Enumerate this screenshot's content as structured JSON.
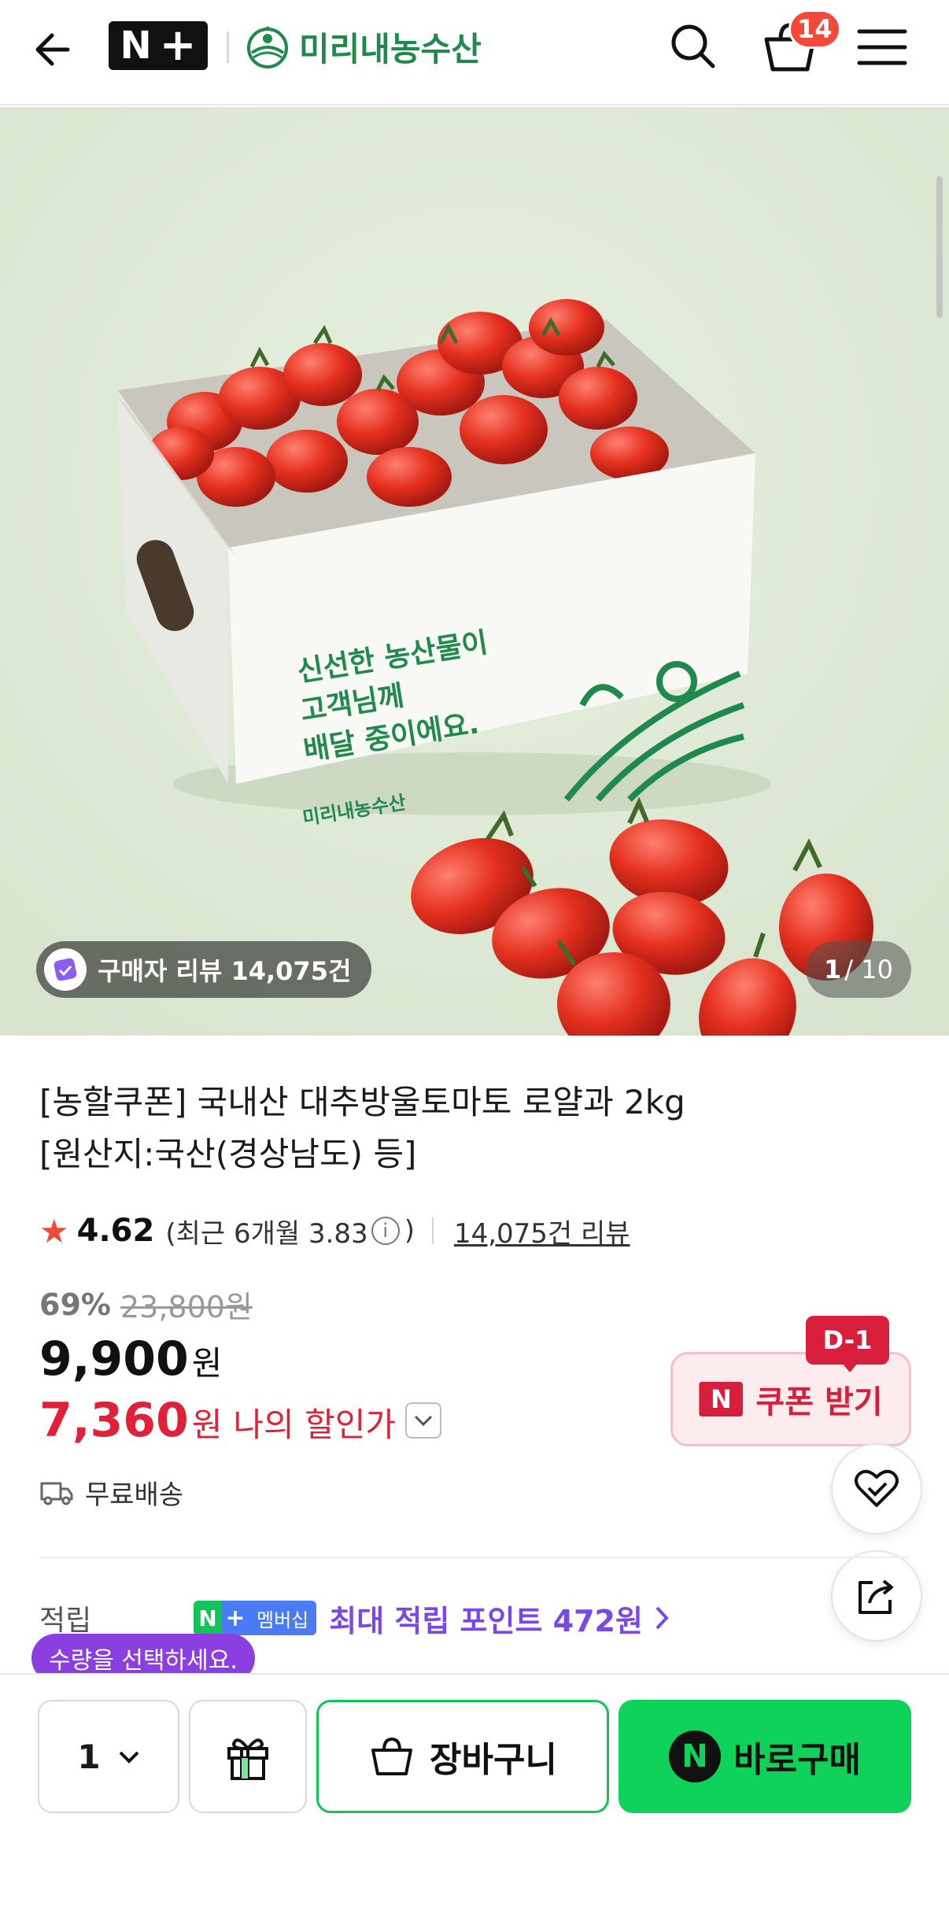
{
  "header": {
    "nplus_logo": "N",
    "store_name": "미리내농수산",
    "cart_count": "14"
  },
  "gallery": {
    "box_text_line1": "신선한 농산물이",
    "box_text_line2": "고객님께",
    "box_text_line3": "배달 중이에요.",
    "box_brand": "미리내농수산",
    "review_pill": "구매자 리뷰 14,075건",
    "page_current": "1",
    "page_total": "/ 10"
  },
  "product": {
    "title_line1": "[농할쿠폰] 국내산 대추방울토마토 로얄과 2kg",
    "title_line2": "[원산지:국산(경상남도) 등]",
    "rating": "4.62",
    "recent_rating": "(최근 6개월 3.83",
    "recent_close": ")",
    "review_link": "14,075건 리뷰",
    "discount_rate": "69%",
    "original_price": "23,800원",
    "price": "9,900",
    "price_unit": "원",
    "my_price": "7,360",
    "my_price_unit": "원",
    "my_price_label": "나의 할인가",
    "shipping": "무료배송"
  },
  "coupon": {
    "dday": "D-1",
    "label": "쿠폰 받기",
    "n_mark": "N"
  },
  "points": {
    "label": "적립",
    "badge_n": "N",
    "badge_plus": "+",
    "badge_text": "멤버십",
    "text": "최대 적립 포인트 472원"
  },
  "tooltip": {
    "text": "수량을 선택하세요."
  },
  "bottom": {
    "qty": "1",
    "cart_label": "장바구니",
    "buy_label": "바로구매",
    "buy_n": "N"
  },
  "colors": {
    "accent_green": "#0fd25b",
    "sale_red": "#e1203a",
    "points_purple": "#7b48e8",
    "badge_red": "#f3493a"
  },
  "icons": [
    "back-arrow-icon",
    "search-icon",
    "cart-icon",
    "menu-icon",
    "review-icon",
    "info-icon",
    "chevron-down-icon",
    "truck-icon",
    "heart-check-icon",
    "share-icon",
    "chevron-right-icon",
    "gift-icon",
    "bag-icon"
  ]
}
